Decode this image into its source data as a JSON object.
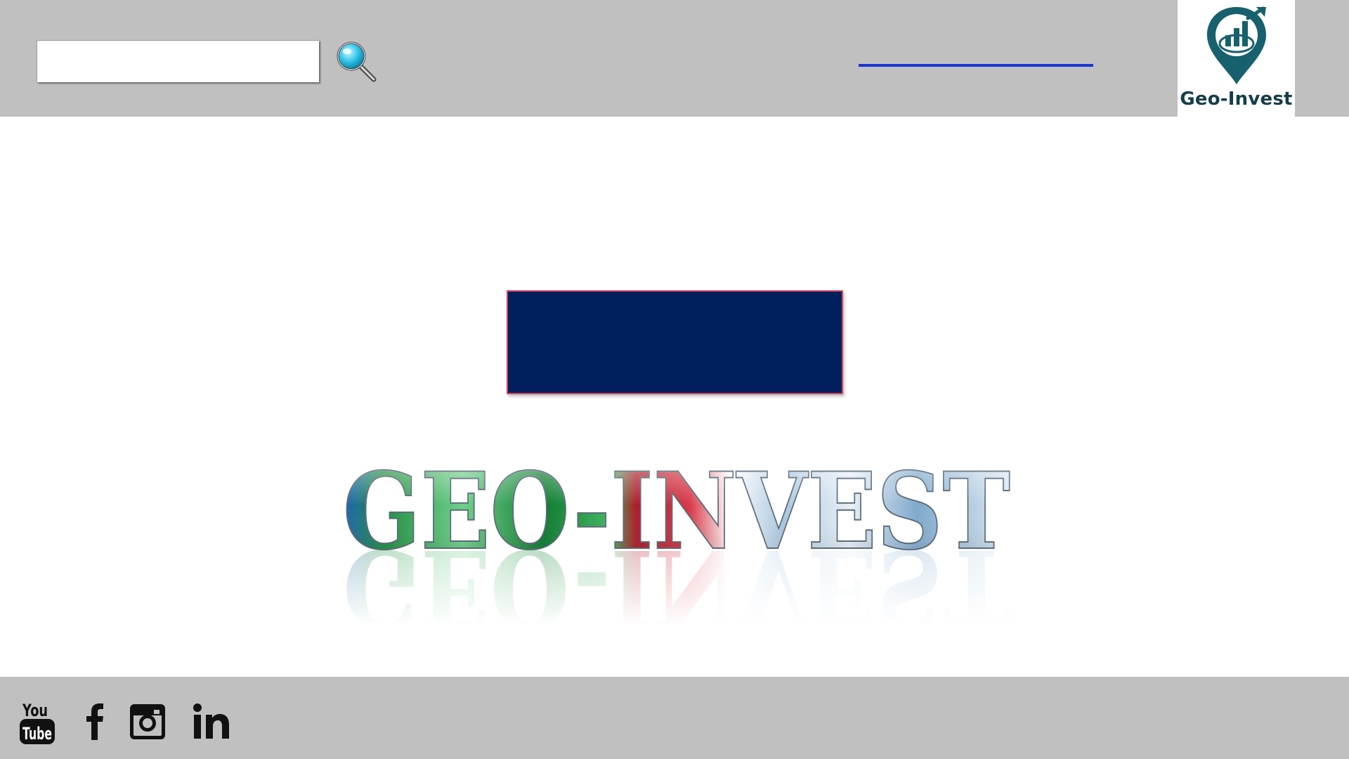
{
  "header": {
    "search": {
      "value": "",
      "placeholder": ""
    },
    "search_button": {
      "icon": "magnifier-icon"
    },
    "link": {
      "text": "",
      "color": "#1a35d6"
    },
    "logo": {
      "name": "Geo-Invest",
      "icon": "map-pin-chart-icon",
      "color": "#153d4a"
    }
  },
  "main": {
    "cta": {
      "label": "",
      "color": "#001f5c",
      "border_color": "#d04a62"
    },
    "hero_title": "GEO-INVEST"
  },
  "footer": {
    "social": [
      {
        "name": "YouTube",
        "icon": "youtube-icon"
      },
      {
        "name": "Facebook",
        "icon": "facebook-icon"
      },
      {
        "name": "Instagram",
        "icon": "instagram-icon"
      },
      {
        "name": "LinkedIn",
        "icon": "linkedin-icon"
      }
    ]
  },
  "colors": {
    "header_bg": "#c0c0c0",
    "footer_bg": "#c0c0c0",
    "page_bg": "#ffffff"
  }
}
